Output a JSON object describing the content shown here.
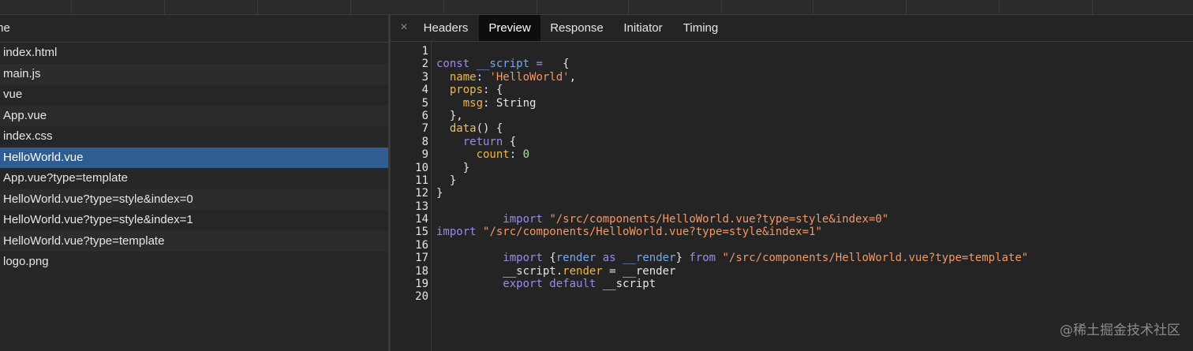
{
  "file_list": {
    "header": "me",
    "items": [
      "index.html",
      "main.js",
      "vue",
      "App.vue",
      "index.css",
      "HelloWorld.vue",
      "App.vue?type=template",
      "HelloWorld.vue?type=style&index=0",
      "HelloWorld.vue?type=style&index=1",
      "HelloWorld.vue?type=template",
      "logo.png"
    ],
    "selected": "HelloWorld.vue"
  },
  "tabs": {
    "close_glyph": "×",
    "items": [
      "Headers",
      "Preview",
      "Response",
      "Initiator",
      "Timing"
    ],
    "active": "Preview"
  },
  "code_lines": [
    [],
    [
      [
        "kw",
        "const "
      ],
      [
        "var",
        "__script"
      ],
      [
        "kw",
        " = "
      ],
      [
        "",
        "  {"
      ]
    ],
    [
      [
        "",
        "  "
      ],
      [
        "prop",
        "name"
      ],
      [
        "",
        ": "
      ],
      [
        "str",
        "'HelloWorld'"
      ],
      [
        "",
        ","
      ]
    ],
    [
      [
        "",
        "  "
      ],
      [
        "prop",
        "props"
      ],
      [
        "",
        ": {"
      ]
    ],
    [
      [
        "",
        "    "
      ],
      [
        "prop",
        "msg"
      ],
      [
        "",
        ": String"
      ]
    ],
    [
      [
        "",
        "  },"
      ]
    ],
    [
      [
        "",
        "  "
      ],
      [
        "fn",
        "data"
      ],
      [
        "",
        "() {"
      ]
    ],
    [
      [
        "",
        "    "
      ],
      [
        "kw",
        "return"
      ],
      [
        "",
        " {"
      ]
    ],
    [
      [
        "",
        "      "
      ],
      [
        "prop",
        "count"
      ],
      [
        "",
        ": "
      ],
      [
        "num",
        "0"
      ]
    ],
    [
      [
        "",
        "    }"
      ]
    ],
    [
      [
        "",
        "  }"
      ]
    ],
    [
      [
        "",
        "}"
      ]
    ],
    [],
    [
      [
        "",
        "          "
      ],
      [
        "kw",
        "import "
      ],
      [
        "str",
        "\"/src/components/HelloWorld.vue?type=style&index=0\""
      ]
    ],
    [
      [
        "kw",
        "import "
      ],
      [
        "str",
        "\"/src/components/HelloWorld.vue?type=style&index=1\""
      ]
    ],
    [],
    [
      [
        "",
        "          "
      ],
      [
        "kw",
        "import "
      ],
      [
        "",
        "{"
      ],
      [
        "var",
        "render"
      ],
      [
        "kw",
        " as "
      ],
      [
        "var",
        "__render"
      ],
      [
        "",
        "} "
      ],
      [
        "kw",
        "from "
      ],
      [
        "str",
        "\"/src/components/HelloWorld.vue?type=template\""
      ]
    ],
    [
      [
        "",
        "          __script."
      ],
      [
        "prop",
        "render"
      ],
      [
        "",
        " = __render"
      ]
    ],
    [
      [
        "",
        "          "
      ],
      [
        "kw",
        "export default "
      ],
      [
        "",
        "__script"
      ]
    ],
    []
  ],
  "watermark": "@稀土掘金技术社区",
  "colors": {
    "selected_row": "#2f5c91",
    "keyword": "#9c8ae8",
    "string": "#f29766",
    "property": "#f0b64a",
    "number": "#9ee6a3"
  }
}
